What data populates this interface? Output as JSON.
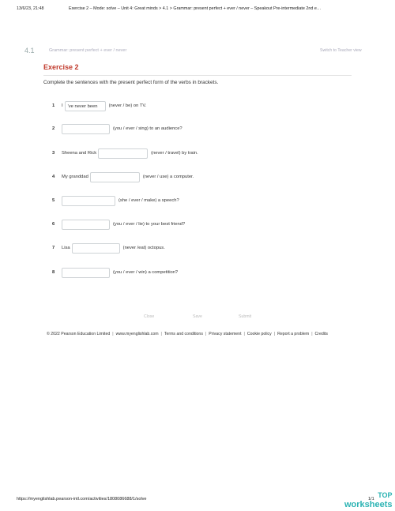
{
  "print_header": {
    "timestamp": "13/6/23, 21:48",
    "title": "Exercise 2 – Mode: solve – Unit 4: Great minds > 4.1 > Grammar: present perfect + ever / never – Speakout Pre-intermediate 2nd e…"
  },
  "section": {
    "number": "4.1",
    "title": "Grammar: present perfect + ever / never",
    "teacher_link": "Switch to Teacher view"
  },
  "exercise": {
    "title": "Exercise 2",
    "instruction": "Complete the sentences with the present perfect form of the verbs in brackets."
  },
  "items": [
    {
      "num": "1",
      "pre": "I",
      "value": "'ve never been",
      "post": "(never / be) on TV."
    },
    {
      "num": "2",
      "pre": "",
      "value": "",
      "post": "(you / ever / sing) to an audience?"
    },
    {
      "num": "3",
      "pre": "Sheena and Rick",
      "value": "",
      "post": "(never / travel) by train."
    },
    {
      "num": "4",
      "pre": "My granddad",
      "value": "",
      "post": "(never / use) a computer."
    },
    {
      "num": "5",
      "pre": "",
      "value": "",
      "post": "(she / ever / make) a speech?"
    },
    {
      "num": "6",
      "pre": "",
      "value": "",
      "post": "(you / ever / lie) to your best friend?"
    },
    {
      "num": "7",
      "pre": "Lisa",
      "value": "",
      "post": "(never /eat) octopus."
    },
    {
      "num": "8",
      "pre": "",
      "value": "",
      "post": "(you / ever / win) a competition?"
    }
  ],
  "actions": {
    "close": "Close",
    "save": "Save",
    "submit": "Submit"
  },
  "footer": {
    "copyright": "© 2022 Pearson Education Limited",
    "links": [
      "www.myenglishlab.com",
      "Terms and conditions",
      "Privacy statement",
      "Cookie policy",
      "Report a problem",
      "Credits"
    ]
  },
  "print_footer": {
    "url": "https://myenglishlab.pearson-intl.com/activities/1808086688/1/solve",
    "page": "1/1"
  },
  "watermark": {
    "top": "TOP",
    "bottom": "worksheets"
  }
}
